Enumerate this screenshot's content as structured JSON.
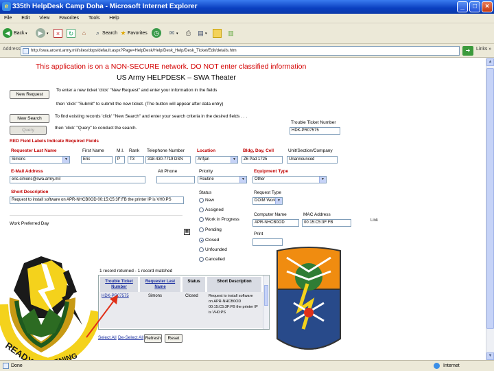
{
  "window": {
    "title": "335th HelpDesk Camp Doha - Microsoft Internet Explorer",
    "controls": {
      "minimize": "_",
      "maximize": "□",
      "close": "×"
    }
  },
  "menu": [
    "File",
    "Edit",
    "View",
    "Favorites",
    "Tools",
    "Help"
  ],
  "toolbar": {
    "back": "Back",
    "search": "Search",
    "favorites": "Favorites"
  },
  "address": {
    "label": "Address",
    "url": "http://swa.arcent.army.mil/sites/dops/default.aspx?Page=HelpDesk/Help/Desk_Help/Desk_Ticket/Edit/details.htm",
    "go": "Go",
    "links": "Links »"
  },
  "page": {
    "warning": "This application is on a NON-SECURE network. DO NOT enter classified information",
    "heading": "US Army HELPDESK – SWA Theater",
    "new_request_btn": "New Request",
    "new_request_instr1": "To enter a new ticket 'click' \"New Request\" and enter your information in the fields",
    "new_request_instr2": "then 'click' \"Submit\" to submit the new ticket. (The button will appear after data entry)",
    "new_search_btn": "New Search",
    "new_search_instr": "To find existing records 'click' \"New Search\" and enter your search criteria in the desired fields . . .",
    "query_btn": "Query",
    "query_instr": "then 'click' \"Query\" to conduct the search.",
    "trouble_ticket_label": "Trouble Ticket Number",
    "trouble_ticket_value": "HDK-PR07575",
    "red_fields_note": "RED Field Labels Indicate Required Fields",
    "fields": {
      "last_name": {
        "label": "Requester Last Name",
        "value": "Simons"
      },
      "first_name": {
        "label": "First Name",
        "value": "Eric"
      },
      "mi": {
        "label": "M.I.",
        "value": "P"
      },
      "rank": {
        "label": "Rank",
        "value": "T3"
      },
      "phone": {
        "label": "Telephone Number",
        "value": "318-430-7719 DSN"
      },
      "location": {
        "label": "Location",
        "value": "Arifjan"
      },
      "bldg": {
        "label": "Bldg, Day, Cell",
        "value": "Z6 Pad 1725"
      },
      "unit": {
        "label": "Unit/Section/Company",
        "value": "Unannounced"
      },
      "email": {
        "label": "E-Mail Address",
        "value": "eric.simons@swa.army.mil"
      },
      "alt_phone": {
        "label": "Alt Phone",
        "value": ""
      },
      "priority": {
        "label": "Priority",
        "value": "Routine"
      },
      "equipment": {
        "label": "Equipment Type",
        "value": "Other"
      },
      "short_desc": {
        "label": "Short Description",
        "value": "Request to install software on APR-NHCB0OD 00:15:C5:3F:FB the printer IP is VH0:PS"
      },
      "status": {
        "label": "Status"
      },
      "request_type": {
        "label": "Request Type",
        "value": "DOIM Work"
      },
      "computer_name": {
        "label": "Computer Name",
        "value": "APR-NHCB0OD"
      },
      "mac": {
        "label": "MAC Address",
        "value": "00:15:C5:3F:FB"
      },
      "print": {
        "label": "Print",
        "value": ""
      },
      "preferred_day": {
        "label": "Work Preferred Day"
      }
    },
    "status_options": [
      {
        "label": "New",
        "checked": false
      },
      {
        "label": "Assigned",
        "checked": false
      },
      {
        "label": "Work in Progress",
        "checked": false
      },
      {
        "label": "Pending",
        "checked": false
      },
      {
        "label": "Closed",
        "checked": true
      },
      {
        "label": "Unfounded",
        "checked": false
      },
      {
        "label": "Cancelled",
        "checked": false
      }
    ],
    "side_link": "Link",
    "results": {
      "caption": "1 record returned - 1 record matched",
      "headers": [
        "Trouble Ticket Number",
        "Requester Last Name",
        "Status",
        "Short Description"
      ],
      "row": {
        "ticket": "HDK-PR07575",
        "last_name": "Simons",
        "status": "Closed",
        "desc": "Request to install software on APR-NHCB0OD 00:15:C5:3F:FB the printer IP is VH0:PS"
      }
    },
    "bottom_links": [
      "Select All",
      "De-Select All"
    ],
    "bottom_buttons": [
      "Refresh",
      "Reset"
    ]
  },
  "logos": {
    "left": {
      "text_top": "READY",
      "text_bottom": "LIGHTNING"
    }
  },
  "status": {
    "left": "Done",
    "zone": "Internet"
  },
  "colors": {
    "warning": "#d40000",
    "required": "#c00000",
    "xp_blue": "#0a3fc0",
    "arrow": "#e03018"
  }
}
